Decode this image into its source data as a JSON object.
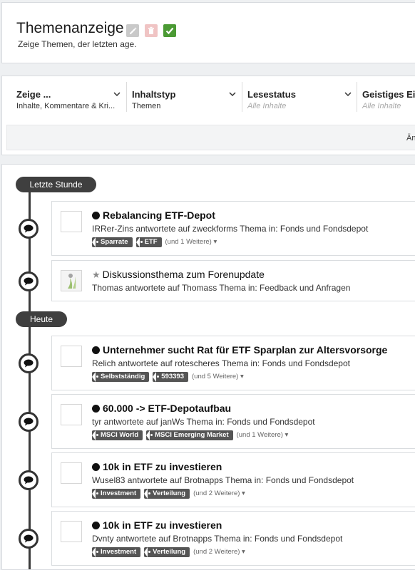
{
  "header": {
    "title": "Themenanzeige",
    "subtitle": "Zeige Themen, der letzten age."
  },
  "filters": [
    {
      "title": "Zeige ...",
      "value": "Inhalte, Kommentare & Kri..."
    },
    {
      "title": "Inhaltstyp",
      "value": "Themen"
    },
    {
      "title": "Lesestatus",
      "value": "Alle Inhalte"
    },
    {
      "title": "Geistiges Ei",
      "value": "Alle Inhalte"
    }
  ],
  "subbar_text": "Änd",
  "groups": [
    "Letzte Stunde",
    "Heute"
  ],
  "items": [
    {
      "title": "Rebalancing ETF-Depot",
      "desc": "IRRer-Zins antwortete auf zweckforms Thema in: Fonds und Fondsdepot",
      "tags": [
        "Sparrate",
        "ETF"
      ],
      "more": "(und 1 Weitere)"
    },
    {
      "title": "Diskussionsthema zum Forenupdate",
      "desc": "Thomas antwortete auf Thomass Thema in: Feedback und Anfragen"
    },
    {
      "title": "Unternehmer sucht Rat für ETF Sparplan zur Altersvorsorge",
      "desc": "Relich antwortete auf rotescheres Thema in: Fonds und Fondsdepot",
      "tags": [
        "Selbstständig",
        "593393"
      ],
      "more": "(und 5 Weitere)"
    },
    {
      "title": "60.000 -> ETF-Depotaufbau",
      "desc": "tyr antwortete auf janWs Thema in: Fonds und Fondsdepot",
      "tags": [
        "MSCI World",
        "MSCI Emerging Market"
      ],
      "more": "(und 1 Weitere)"
    },
    {
      "title": "10k in ETF zu investieren",
      "desc": "Wusel83 antwortete auf Brotnapps Thema in: Fonds und Fondsdepot",
      "tags": [
        "Investment",
        "Verteilung"
      ],
      "more": "(und 2 Weitere)"
    },
    {
      "title": "10k in ETF zu investieren",
      "desc": "Dvnty antwortete auf Brotnapps Thema in: Fonds und Fondsdepot",
      "tags": [
        "Investment",
        "Verteilung"
      ],
      "more": "(und 2 Weitere)"
    }
  ]
}
